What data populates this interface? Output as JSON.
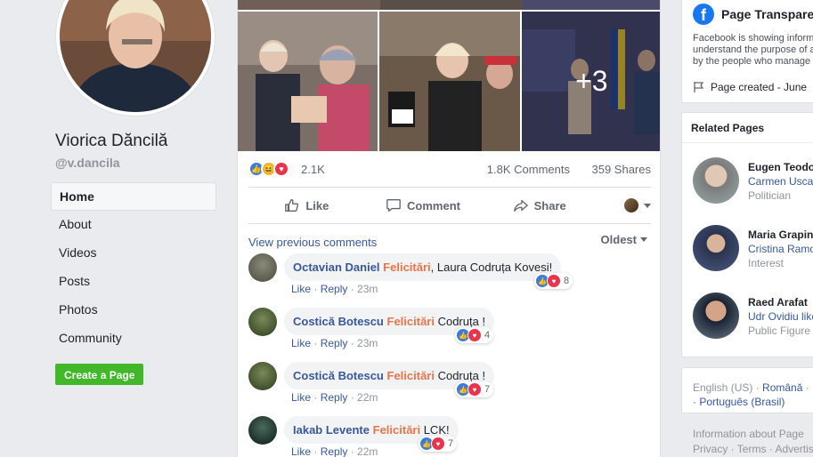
{
  "sidebar": {
    "page_name": "Viorica Dăncilă",
    "handle": "@v.dancila",
    "nav": [
      {
        "label": "Home",
        "active": true
      },
      {
        "label": "About"
      },
      {
        "label": "Videos"
      },
      {
        "label": "Posts"
      },
      {
        "label": "Photos"
      },
      {
        "label": "Community"
      }
    ],
    "create_page": "Create a Page"
  },
  "post": {
    "more_photos": "+3",
    "reactions_count": "2.1K",
    "comments_count": "1.8K Comments",
    "shares_count": "359 Shares",
    "actions": {
      "like": "Like",
      "comment": "Comment",
      "share": "Share"
    },
    "view_previous": "View previous comments",
    "sort": "Oldest",
    "comments": [
      {
        "name": "Octavian Daniel",
        "tag": "Felicitări",
        "text": ", Laura Codruța Kovesi!",
        "reactions": "8",
        "like": "Like",
        "reply": "Reply",
        "time": "· 23m"
      },
      {
        "name": "Costică Botescu",
        "tag": "Felicitări",
        "text": " Codruța !",
        "reactions": "4",
        "like": "Like",
        "reply": "Reply",
        "time": "· 23m"
      },
      {
        "name": "Costică Botescu",
        "tag": "Felicitări",
        "text": " Codruța !",
        "reactions": "7",
        "like": "Like",
        "reply": "Reply",
        "time": "· 22m"
      },
      {
        "name": "Iakab Levente",
        "tag": "Felicitări",
        "text": " LCK!",
        "reactions": "7",
        "like": "Like",
        "reply": "Reply",
        "time": "· 22m"
      }
    ]
  },
  "transparency": {
    "title": "Page Transparency",
    "lines": [
      "Facebook is showing information to help you",
      "understand the purpose of a Page. See actions taken",
      "by the people who manage and post content."
    ],
    "created": "Page created - June"
  },
  "related": {
    "heading": "Related Pages",
    "items": [
      {
        "name": "Eugen Teodorovici",
        "sub": "Carmen Uscatu",
        "cat": "Politician"
      },
      {
        "name": "Maria Grapini",
        "sub": "Cristina Ramona",
        "cat": "Interest"
      },
      {
        "name": "Raed Arafat",
        "sub": "Udr Ovidiu likes",
        "cat": "Public Figure"
      }
    ]
  },
  "languages": {
    "current": "English (US) ·",
    "romana": "Română",
    "sep": "·",
    "portugues": "· Português (Brasil)"
  },
  "footer": {
    "line1": "Information about Page",
    "line2": "Privacy · Terms · Advertising"
  }
}
